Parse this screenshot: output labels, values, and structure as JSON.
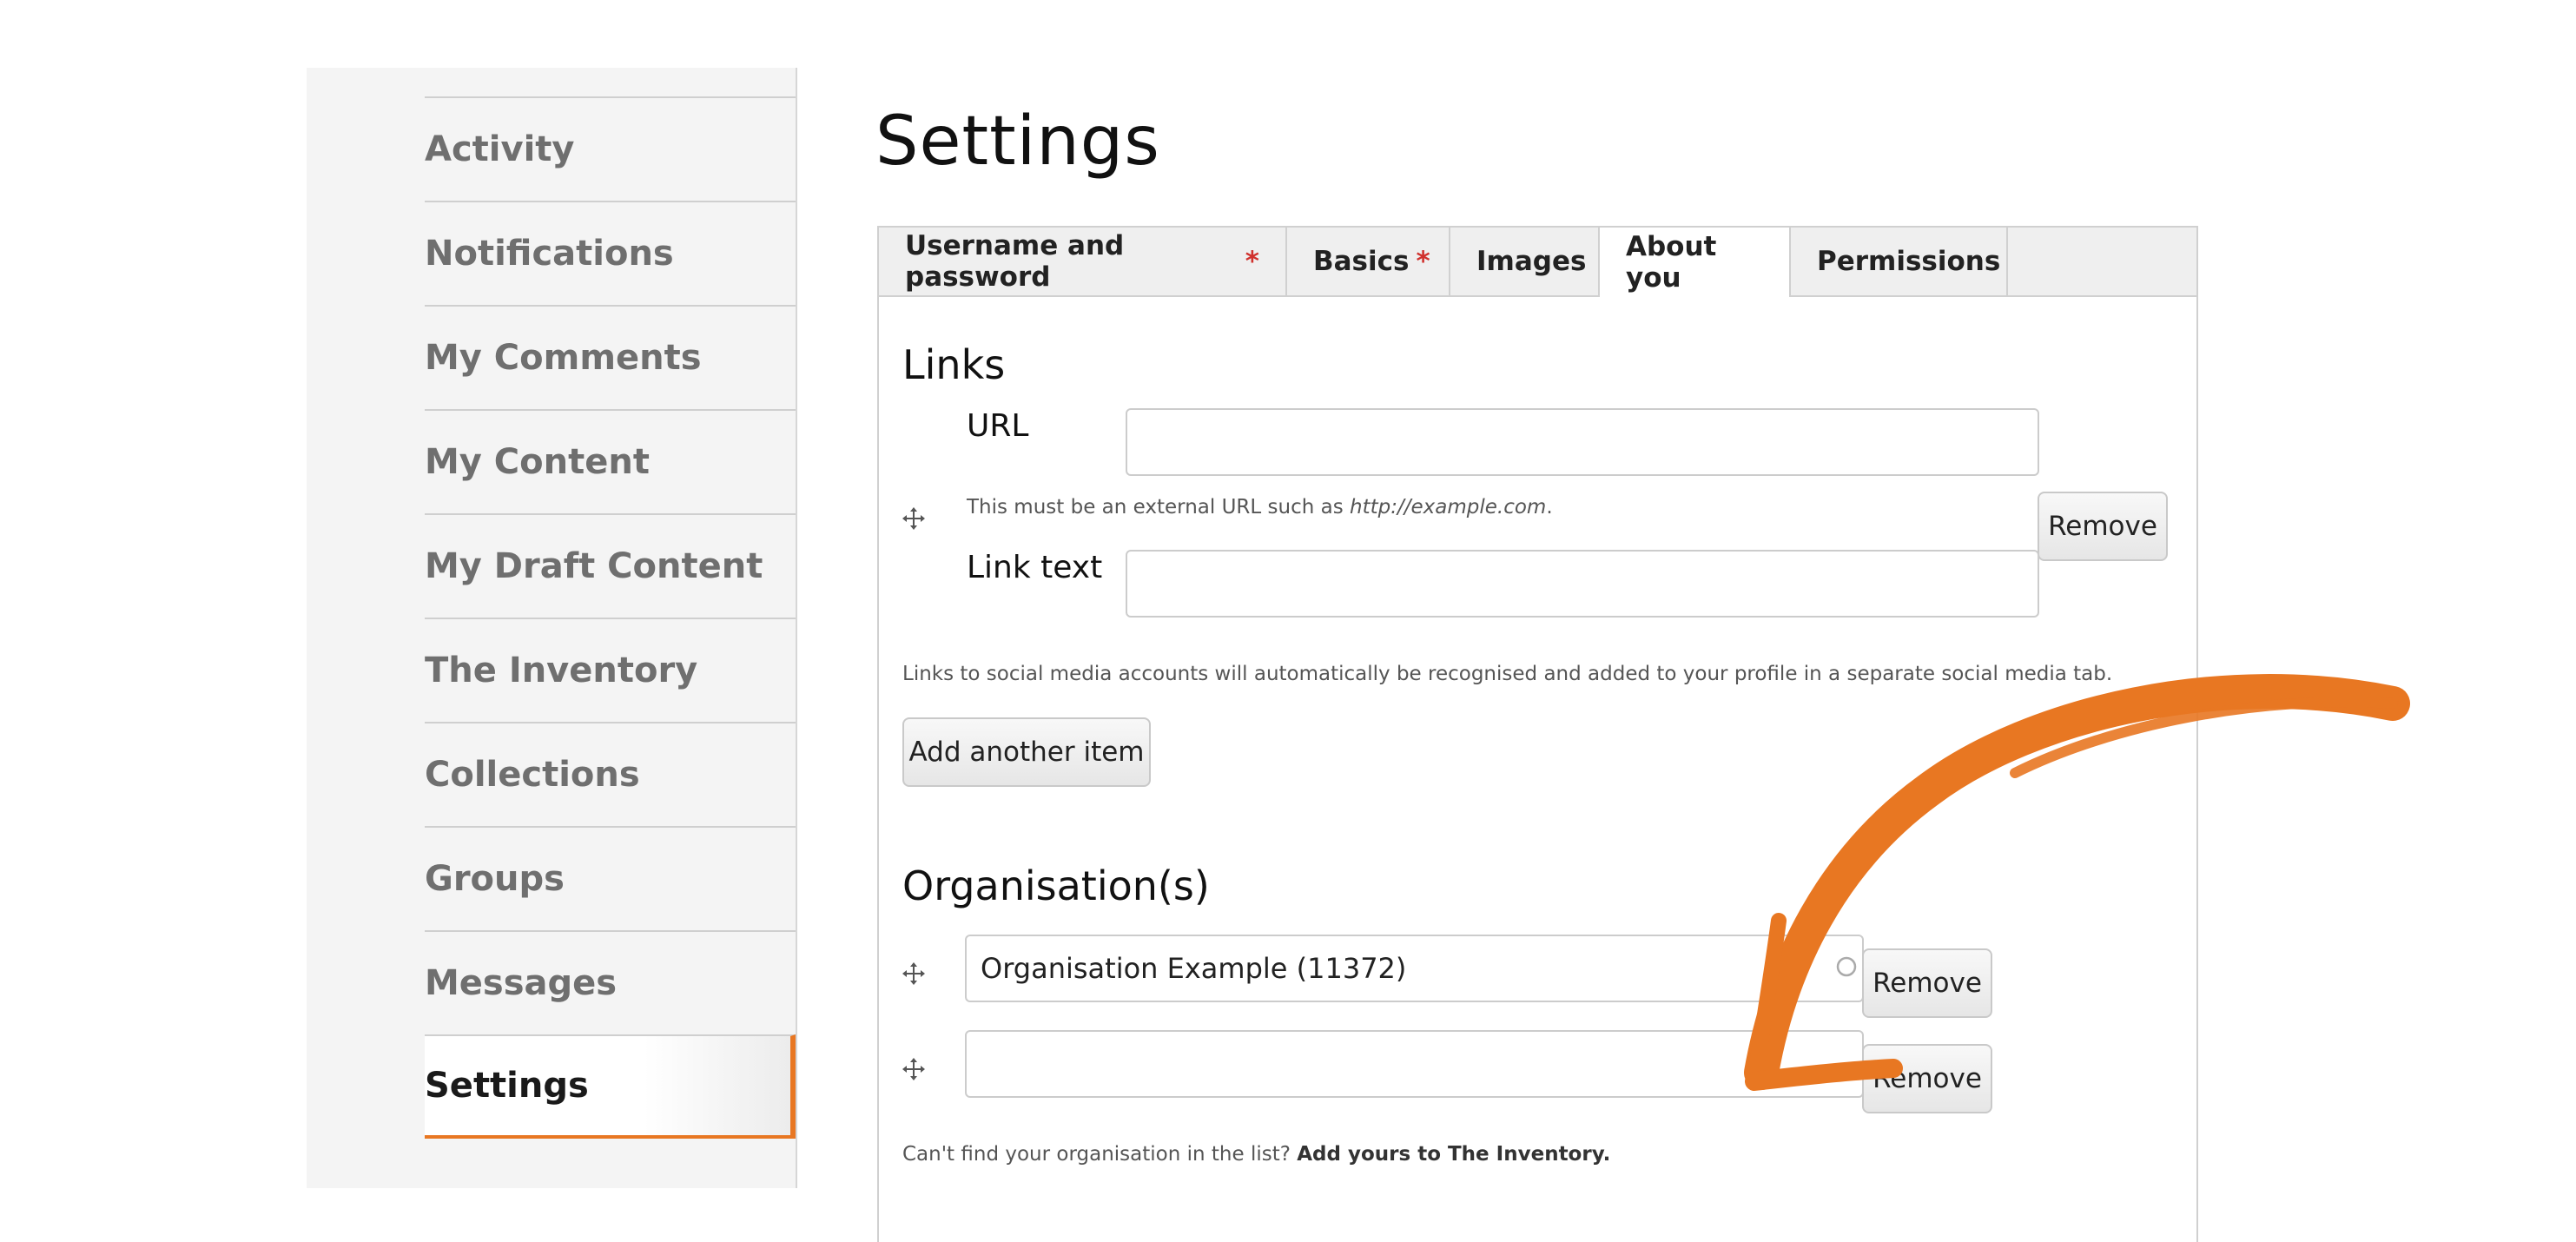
{
  "sidebar": {
    "items": [
      {
        "label": "Activity"
      },
      {
        "label": "Notifications"
      },
      {
        "label": "My Comments"
      },
      {
        "label": "My Content"
      },
      {
        "label": "My Draft Content"
      },
      {
        "label": "The Inventory"
      },
      {
        "label": "Collections"
      },
      {
        "label": "Groups"
      },
      {
        "label": "Messages"
      },
      {
        "label": "Settings",
        "active": true
      }
    ]
  },
  "page": {
    "title": "Settings"
  },
  "tabs": [
    {
      "label": "Username and password",
      "required": "*"
    },
    {
      "label": "Basics",
      "required": "*"
    },
    {
      "label": "Images"
    },
    {
      "label": "About you",
      "active": true
    },
    {
      "label": "Permissions"
    }
  ],
  "links": {
    "title": "Links",
    "url_label": "URL",
    "url_value": "",
    "url_help_prefix": "This must be an external URL such as ",
    "url_help_example": "http://example.com",
    "url_help_suffix": ".",
    "link_text_label": "Link text",
    "link_text_value": "",
    "remove_label": "Remove",
    "social_help": "Links to social media accounts will automatically be recognised and added to your profile in a separate social media tab.",
    "add_another_label": "Add another item"
  },
  "organisations": {
    "title": "Organisation(s)",
    "items": [
      {
        "value": "Organisation Example (11372)",
        "remove_label": "Remove"
      },
      {
        "value": "",
        "remove_label": "Remove"
      }
    ],
    "help_prefix": "Can't find your organisation in the list? ",
    "help_link": "Add yours to The Inventory."
  },
  "colors": {
    "accent": "#e87722",
    "required": "#d0312d"
  },
  "icons": {
    "drag_handle": "move-arrows-icon",
    "autocomplete": "autocomplete-throbber-icon"
  }
}
